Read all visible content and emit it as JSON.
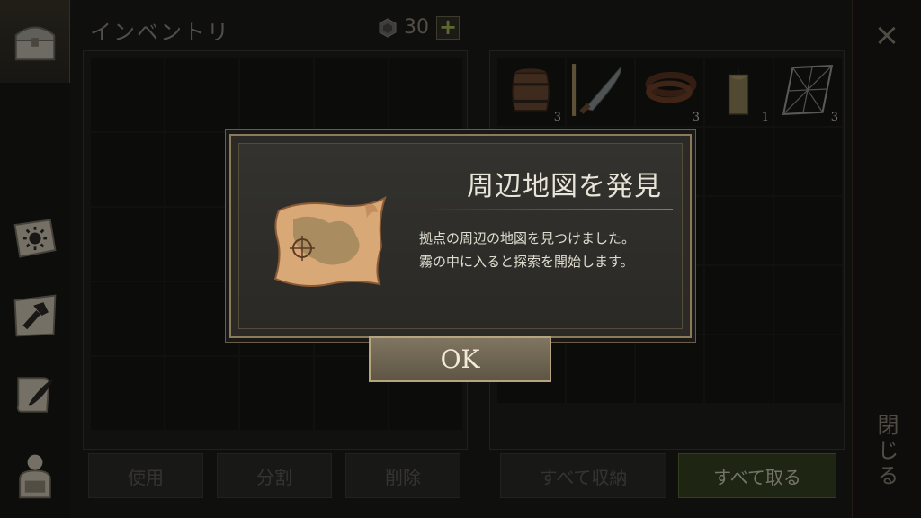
{
  "header": {
    "title": "インベントリ",
    "gem_count": "30",
    "plus_label": "+"
  },
  "inventory_slots": 25,
  "storage": {
    "items": [
      {
        "icon": "barrel-icon",
        "qty": "3"
      },
      {
        "icon": "machete-icon",
        "qty": ""
      },
      {
        "icon": "leather-strap-icon",
        "qty": "3"
      },
      {
        "icon": "candle-icon",
        "qty": "1"
      },
      {
        "icon": "net-icon",
        "qty": "3"
      }
    ]
  },
  "buttons": {
    "use": "使用",
    "split": "分割",
    "delete": "削除",
    "store_all": "すべて収納",
    "take_all": "すべて取る"
  },
  "close": {
    "x": "×",
    "label": "閉じる"
  },
  "dialog": {
    "title": "周辺地図を発見",
    "message_line1": "拠点の周辺の地図を見つけました。",
    "message_line2": "霧の中に入ると探索を開始します。",
    "ok_label": "OK"
  },
  "colors": {
    "accent_gold": "#8c7b58",
    "green_button": "#34401f",
    "background": "#1b1b19"
  }
}
